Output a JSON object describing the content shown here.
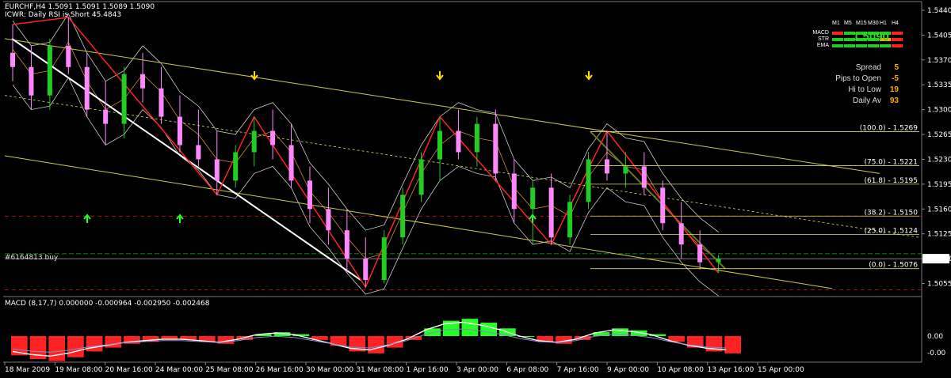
{
  "header": {
    "symbol_line": "EURCHF,H4  1.5091 1.5091 1.5089 1.5090",
    "rsi_line": "ICWR: Daily RSI is Short 45.4843",
    "order_label": "#6164813 buy",
    "macd_line": "MACD  (8,17,7) 0.000000 -0.000964 -0.002950 -0.002468"
  },
  "panel": {
    "timeframes": [
      "M1",
      "M5",
      "M15",
      "M30",
      "H1",
      "H4"
    ],
    "rows": [
      {
        "label": "MACD",
        "colors": [
          "#ff2222",
          "#22cc22",
          "#22cc22",
          "#22cc22",
          "#22cc22",
          "#ff2222"
        ]
      },
      {
        "label": "STR",
        "colors": [
          "#22cc22",
          "#22cc22",
          "#22cc22",
          "#22cc22",
          "#ffaa00",
          "#ff2222"
        ]
      },
      {
        "label": "EMA",
        "colors": [
          "#22cc22",
          "#22cc22",
          "#22cc22",
          "#22cc22",
          "#22cc22",
          "#ff2222"
        ]
      }
    ],
    "price": "1.5090",
    "stats": [
      {
        "label": "Spread",
        "value": "5"
      },
      {
        "label": "Pips to Open",
        "value": "-5"
      },
      {
        "label": "Hi to Low",
        "value": "19"
      },
      {
        "label": "Daily Av",
        "value": "93"
      }
    ]
  },
  "colors": {
    "background": "#000000",
    "bull_candle": "#22cc22",
    "bear_candle": "#ff88ff",
    "zigzag": "#ff2222",
    "channel": "#cccc44",
    "bollinger": "#cccccc",
    "fib": "#dddd66",
    "macd_pos": "#22ff22",
    "macd_neg": "#ff2222",
    "signal_arrow_down": "#ffdd00",
    "signal_arrow_up": "#22ff22"
  },
  "chart_data": {
    "type": "candlestick",
    "price_axis": {
      "ticks": [
        "1.5440",
        "1.5405",
        "1.5370",
        "1.5335",
        "1.5300",
        "1.5265",
        "1.5230",
        "1.5195",
        "1.5160",
        "1.5125",
        "1.5090",
        "1.5055"
      ],
      "ylim": [
        1.504,
        1.545
      ],
      "current_price": "1.5090"
    },
    "time_axis": {
      "ticks": [
        "18 Mar 2009",
        "19 Mar 08:00",
        "20 Mar 16:00",
        "24 Mar 00:00",
        "25 Mar 08:00",
        "26 Mar 16:00",
        "30 Mar 00:00",
        "31 Mar 08:00",
        "1 Apr 16:00",
        "3 Apr 00:00",
        "6 Apr 08:00",
        "7 Apr 16:00",
        "9 Apr 00:00",
        "10 Apr 08:00",
        "13 Apr 16:00",
        "15 Apr 00:00"
      ]
    },
    "fibonacci_levels": [
      {
        "label": "(100.0) - 1.5269",
        "price": 1.5269
      },
      {
        "label": "(75.0) - 1.5221",
        "price": 1.5221
      },
      {
        "label": "(61.8) - 1.5195",
        "price": 1.5195
      },
      {
        "label": "(38.2) - 1.5150",
        "price": 1.515
      },
      {
        "label": "(25.0) - 1.5124",
        "price": 1.5124
      },
      {
        "label": "(0.0) - 1.5076",
        "price": 1.5076
      }
    ],
    "candles": [
      {
        "o": 1.538,
        "h": 1.542,
        "l": 1.534,
        "c": 1.536
      },
      {
        "o": 1.536,
        "h": 1.539,
        "l": 1.53,
        "c": 1.532
      },
      {
        "o": 1.532,
        "h": 1.54,
        "l": 1.53,
        "c": 1.539
      },
      {
        "o": 1.539,
        "h": 1.543,
        "l": 1.535,
        "c": 1.536
      },
      {
        "o": 1.536,
        "h": 1.538,
        "l": 1.529,
        "c": 1.53
      },
      {
        "o": 1.53,
        "h": 1.534,
        "l": 1.525,
        "c": 1.528
      },
      {
        "o": 1.528,
        "h": 1.536,
        "l": 1.526,
        "c": 1.535
      },
      {
        "o": 1.535,
        "h": 1.538,
        "l": 1.531,
        "c": 1.533
      },
      {
        "o": 1.533,
        "h": 1.536,
        "l": 1.528,
        "c": 1.529
      },
      {
        "o": 1.529,
        "h": 1.532,
        "l": 1.524,
        "c": 1.525
      },
      {
        "o": 1.525,
        "h": 1.53,
        "l": 1.522,
        "c": 1.523
      },
      {
        "o": 1.523,
        "h": 1.527,
        "l": 1.518,
        "c": 1.52
      },
      {
        "o": 1.52,
        "h": 1.525,
        "l": 1.519,
        "c": 1.524
      },
      {
        "o": 1.524,
        "h": 1.529,
        "l": 1.522,
        "c": 1.527
      },
      {
        "o": 1.527,
        "h": 1.53,
        "l": 1.523,
        "c": 1.525
      },
      {
        "o": 1.525,
        "h": 1.528,
        "l": 1.519,
        "c": 1.52
      },
      {
        "o": 1.52,
        "h": 1.522,
        "l": 1.514,
        "c": 1.516
      },
      {
        "o": 1.516,
        "h": 1.519,
        "l": 1.511,
        "c": 1.513
      },
      {
        "o": 1.513,
        "h": 1.516,
        "l": 1.507,
        "c": 1.509
      },
      {
        "o": 1.509,
        "h": 1.512,
        "l": 1.505,
        "c": 1.506
      },
      {
        "o": 1.506,
        "h": 1.513,
        "l": 1.5055,
        "c": 1.512
      },
      {
        "o": 1.512,
        "h": 1.519,
        "l": 1.511,
        "c": 1.518
      },
      {
        "o": 1.518,
        "h": 1.524,
        "l": 1.517,
        "c": 1.523
      },
      {
        "o": 1.523,
        "h": 1.529,
        "l": 1.52,
        "c": 1.527
      },
      {
        "o": 1.527,
        "h": 1.53,
        "l": 1.523,
        "c": 1.524
      },
      {
        "o": 1.524,
        "h": 1.529,
        "l": 1.522,
        "c": 1.528
      },
      {
        "o": 1.528,
        "h": 1.53,
        "l": 1.52,
        "c": 1.521
      },
      {
        "o": 1.521,
        "h": 1.523,
        "l": 1.514,
        "c": 1.516
      },
      {
        "o": 1.516,
        "h": 1.52,
        "l": 1.511,
        "c": 1.519
      },
      {
        "o": 1.519,
        "h": 1.521,
        "l": 1.511,
        "c": 1.512
      },
      {
        "o": 1.512,
        "h": 1.518,
        "l": 1.511,
        "c": 1.517
      },
      {
        "o": 1.517,
        "h": 1.524,
        "l": 1.516,
        "c": 1.523
      },
      {
        "o": 1.523,
        "h": 1.527,
        "l": 1.52,
        "c": 1.521
      },
      {
        "o": 1.521,
        "h": 1.524,
        "l": 1.519,
        "c": 1.522
      },
      {
        "o": 1.522,
        "h": 1.524,
        "l": 1.518,
        "c": 1.519
      },
      {
        "o": 1.519,
        "h": 1.52,
        "l": 1.513,
        "c": 1.514
      },
      {
        "o": 1.514,
        "h": 1.517,
        "l": 1.509,
        "c": 1.511
      },
      {
        "o": 1.511,
        "h": 1.513,
        "l": 1.5075,
        "c": 1.5085
      },
      {
        "o": 1.5085,
        "h": 1.5095,
        "l": 1.507,
        "c": 1.509
      }
    ],
    "macd": {
      "params": "(8,17,7)",
      "histogram": [
        -0.001,
        -0.0012,
        -0.0013,
        -0.0011,
        -0.0008,
        -0.0006,
        -0.0004,
        -0.0003,
        -0.0002,
        -0.0002,
        -0.0003,
        -0.0004,
        -0.0002,
        0.0001,
        0.0002,
        0.0001,
        -0.0002,
        -0.0005,
        -0.0008,
        -0.0009,
        -0.0006,
        -0.0002,
        0.0004,
        0.0008,
        0.0009,
        0.0007,
        0.0004,
        0.0,
        -0.0003,
        -0.0004,
        -0.0002,
        0.0002,
        0.0004,
        0.0003,
        0.0001,
        -0.0003,
        -0.0006,
        -0.0008,
        -0.0009
      ],
      "ticks": [
        "0.00",
        "-0.00"
      ]
    },
    "annotations": {
      "down_arrows": 3,
      "up_arrows": 3
    }
  }
}
